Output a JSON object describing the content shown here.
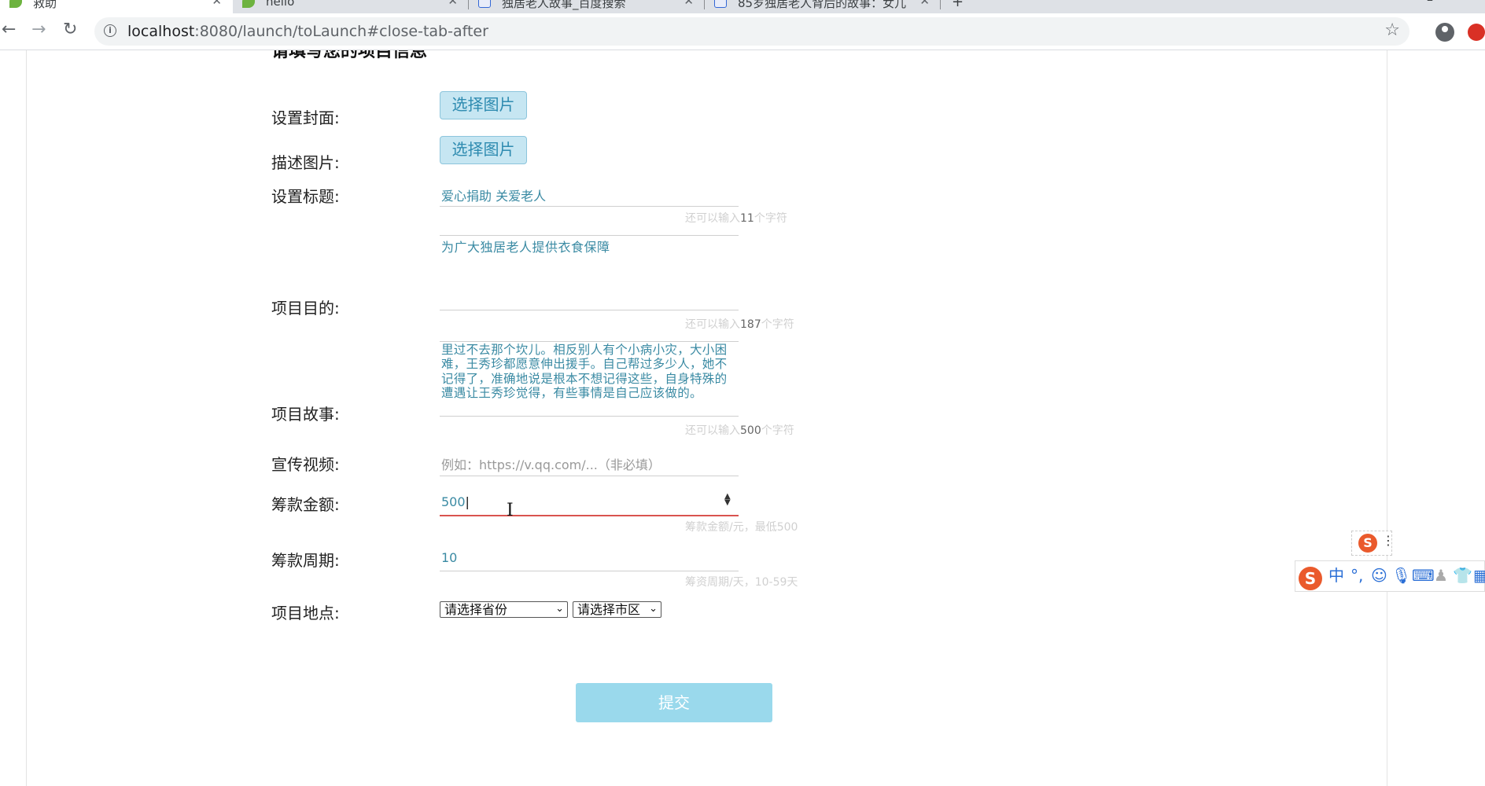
{
  "browser": {
    "tabs": [
      {
        "title": "救助",
        "icon": "leaf-icon",
        "active": true
      },
      {
        "title": "hello",
        "icon": "leaf-icon",
        "active": false
      },
      {
        "title": "独居老人故事_百度搜索",
        "icon": "paw-icon",
        "active": false
      },
      {
        "title": "85岁独居老人背后的故事：女儿",
        "icon": "paw-icon",
        "active": false
      }
    ],
    "url_host": "localhost",
    "url_rest": ":8080/launch/toLaunch#close-tab-after"
  },
  "form": {
    "section_title": "请填写您的项目信息",
    "cover_label": "设置封面:",
    "desc_images_label": "描述图片:",
    "pick_image_label": "选择图片",
    "title_label": "设置标题:",
    "title_value": "爱心捐助 关爱老人",
    "title_hint_pre": "还可以输入",
    "title_hint_count": "11",
    "title_hint_post": "个字符",
    "purpose_label": "项目目的:",
    "purpose_value": "为广大独居老人提供衣食保障",
    "purpose_hint_pre": "还可以输入",
    "purpose_hint_count": "187",
    "purpose_hint_post": "个字符",
    "story_label": "项目故事:",
    "story_value": "里过不去那个坎儿。相反别人有个小病小灾，大小困难，王秀珍都愿意伸出援手。自己帮过多少人，她不记得了，准确地说是根本不想记得这些，自身特殊的遭遇让王秀珍觉得，有些事情是自己应该做的。",
    "story_hint_pre": "还可以输入",
    "story_hint_count": "500",
    "story_hint_post": "个字符",
    "video_label": "宣传视频:",
    "video_placeholder": "例如：https://v.qq.com/...（非必填）",
    "amount_label": "筹款金额:",
    "amount_value": "500",
    "amount_hint": "筹款金额/元，最低500",
    "period_label": "筹款周期:",
    "period_value": "10",
    "period_hint": "筹资周期/天，10-59天",
    "location_label": "项目地点:",
    "province_select": "请选择省份",
    "city_select": "请选择市区",
    "submit_label": "提交"
  },
  "ime": {
    "logo": "S",
    "mode": "中",
    "punct": "°,",
    "items": [
      "emoji-icon",
      "mic-icon",
      "keyboard-icon",
      "user-icon",
      "shirt-icon",
      "grid-icon"
    ]
  },
  "colors": {
    "accent_text": "#3a8aa3",
    "pick_button_bg": "#c6e6f2",
    "submit_bg": "#9ad9ec",
    "error_line": "#d9534f"
  }
}
